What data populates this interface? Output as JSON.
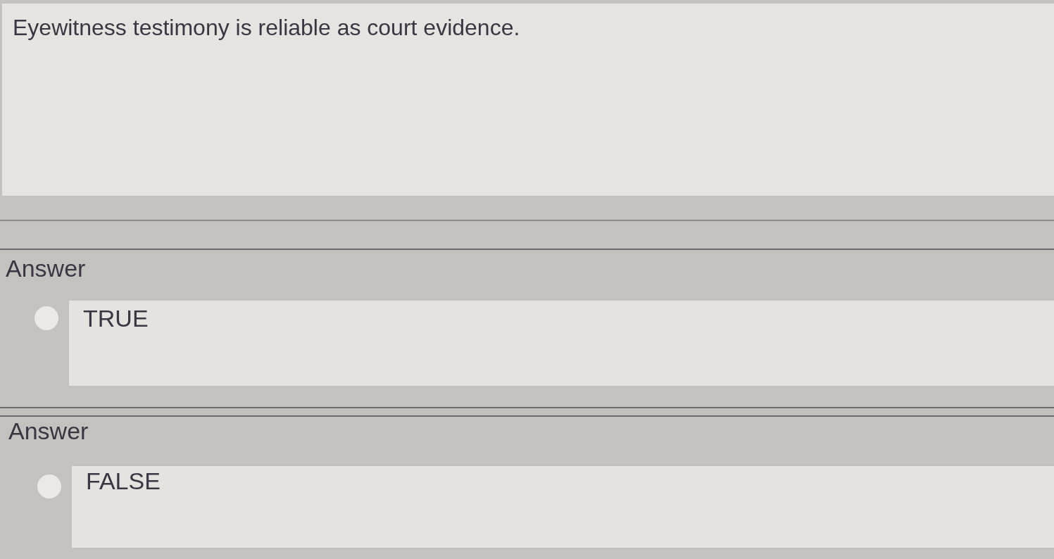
{
  "question": {
    "text": "Eyewitness testimony is reliable as court evidence."
  },
  "options": [
    {
      "heading": "Answer",
      "label": "TRUE",
      "selected": false
    },
    {
      "heading": "Answer",
      "label": "FALSE",
      "selected": false
    }
  ]
}
